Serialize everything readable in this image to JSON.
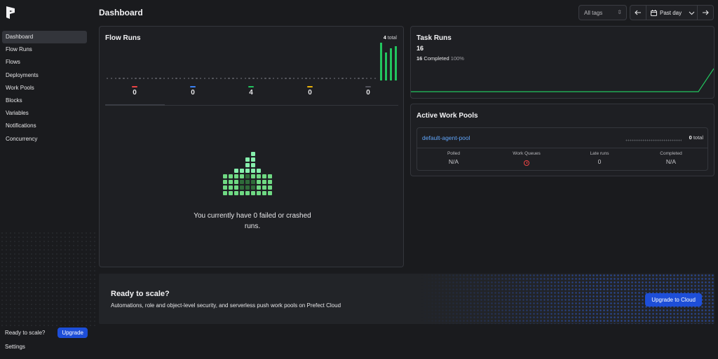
{
  "sidebar": {
    "items": [
      {
        "label": "Dashboard",
        "active": true
      },
      {
        "label": "Flow Runs"
      },
      {
        "label": "Flows"
      },
      {
        "label": "Deployments"
      },
      {
        "label": "Work Pools"
      },
      {
        "label": "Blocks"
      },
      {
        "label": "Variables"
      },
      {
        "label": "Notifications"
      },
      {
        "label": "Concurrency"
      }
    ],
    "promo_text": "Ready to scale?",
    "upgrade_label": "Upgrade",
    "settings_label": "Settings"
  },
  "header": {
    "title": "Dashboard",
    "tags_placeholder": "All tags",
    "date_range_label": "Past day"
  },
  "flow_runs": {
    "title": "Flow Runs",
    "total_number": "4",
    "total_suffix": " total",
    "states": [
      {
        "count": "0",
        "color": "#ef4444"
      },
      {
        "count": "0",
        "color": "#3b82f6"
      },
      {
        "count": "4",
        "color": "#22c55e"
      },
      {
        "count": "0",
        "color": "#eab308"
      },
      {
        "count": "0",
        "color": "#52525b"
      }
    ],
    "empty_message": "You currently have 0 failed or crashed runs.",
    "bar_values": [
      4,
      3,
      3.4,
      3.6
    ]
  },
  "task_runs": {
    "title": "Task Runs",
    "count": "16",
    "completed_count": "16",
    "completed_label": " Completed ",
    "completed_pct": "100%"
  },
  "work_pools": {
    "title": "Active Work Pools",
    "pool_name": "default-agent-pool",
    "total_number": "0",
    "total_suffix": " total",
    "stats": [
      {
        "label": "Polled",
        "value": "N/A"
      },
      {
        "label": "Work Queues",
        "value": ""
      },
      {
        "label": "Late runs",
        "value": "0"
      },
      {
        "label": "Completed",
        "value": "N/A"
      }
    ]
  },
  "banner": {
    "title": "Ready to scale?",
    "text": "Automations, role and object-level security, and serverless push work pools on Prefect Cloud",
    "button_label": "Upgrade to Cloud"
  },
  "colors": {
    "accent_blue": "#1d4ed8",
    "success_green": "#22c55e",
    "link_blue": "#60a5fa",
    "warning_red": "#ef4444"
  }
}
